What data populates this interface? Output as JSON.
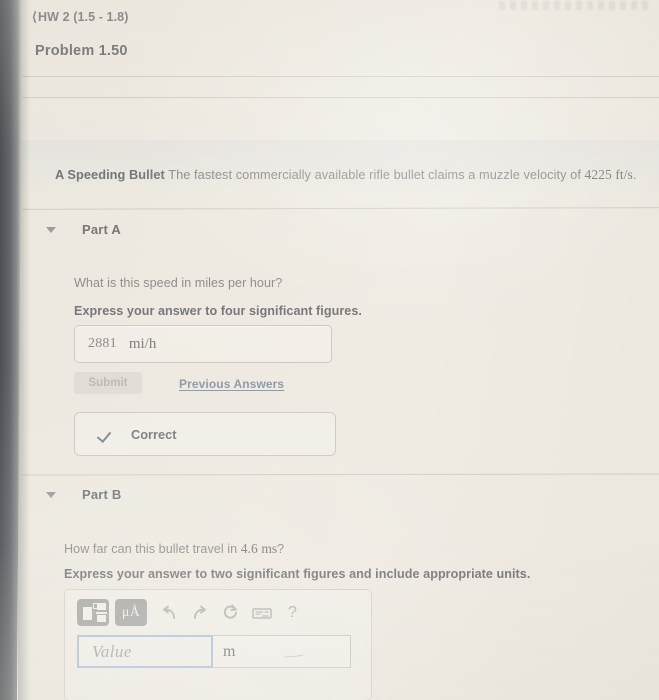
{
  "window": {
    "background_color": "#eeeae2",
    "left_bar_color": "#5b5f63"
  },
  "header": {
    "breadcrumb_chevron": "chevron-left-icon",
    "breadcrumb": "HW 2 (1.5 - 1.8)",
    "page_title": "Problem 1.50"
  },
  "problem": {
    "title": "A Speeding Bullet",
    "body": "The fastest commercially available rifle bullet claims a muzzle velocity of",
    "value": "4225",
    "unit": "ft/s",
    "terminator": "."
  },
  "parts": [
    {
      "caret_icon": "caret-down-icon",
      "label": "Part A",
      "question": "What is this speed in miles per hour?",
      "instruction": "Express your answer to four significant figures.",
      "answer": {
        "value": "2881",
        "unit": "mi/h"
      },
      "submit_label": "Submit",
      "submit_enabled": false,
      "previous_answers_label": "Previous Answers",
      "feedback": {
        "icon": "checkmark-icon",
        "label": "Correct",
        "color": "#7e8a93"
      }
    },
    {
      "caret_icon": "caret-down-icon",
      "label": "Part B",
      "question_prefix": "How far can this bullet travel in",
      "question_value": "4.6",
      "question_unit": "ms",
      "question_suffix": "?",
      "instruction": "Express your answer to two significant figures and include appropriate units.",
      "toolbar": [
        {
          "name": "math-template-icon",
          "label": ""
        },
        {
          "name": "units-icon",
          "label": "μÅ"
        },
        {
          "name": "undo-icon",
          "label": ""
        },
        {
          "name": "redo-icon",
          "label": ""
        },
        {
          "name": "reset-icon",
          "label": ""
        },
        {
          "name": "keyboard-icon",
          "label": ""
        },
        {
          "name": "help-icon",
          "label": "?"
        }
      ],
      "answer": {
        "value": "",
        "placeholder": "Value",
        "unit": "m",
        "focused": true,
        "focus_color": "#aec3d6"
      }
    }
  ]
}
